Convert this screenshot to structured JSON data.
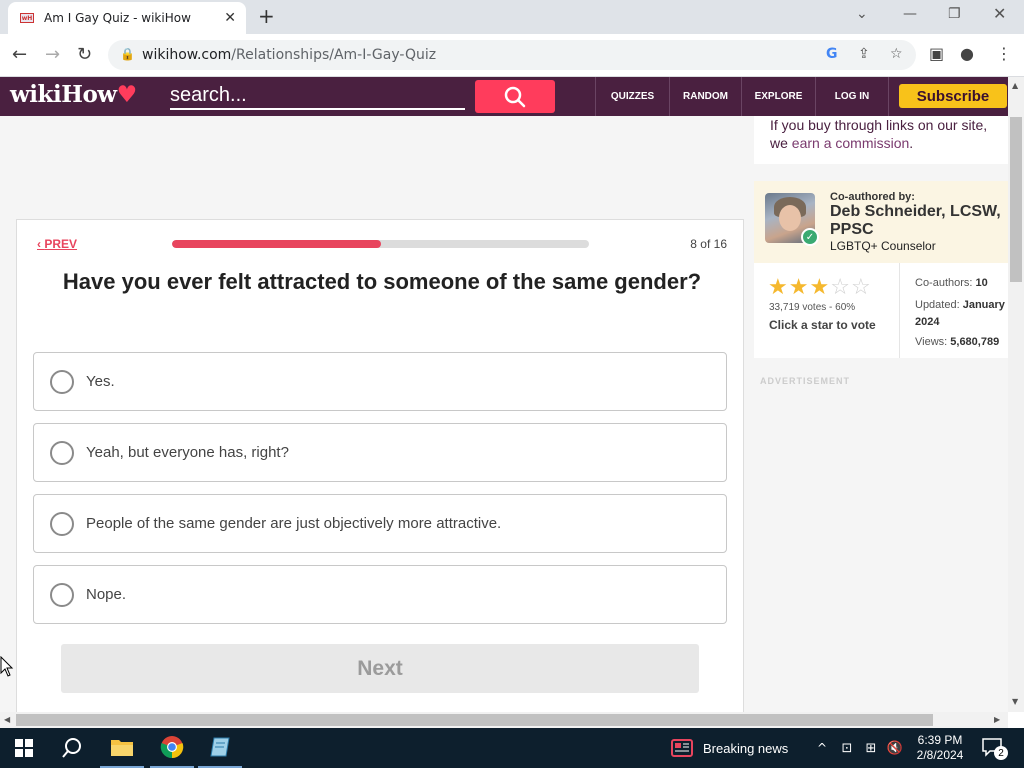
{
  "browser": {
    "tab_title": "Am I Gay Quiz - wikiHow",
    "favicon_text": "wH",
    "new_tab": "+",
    "url_domain": "wikihow.com",
    "url_path": "/Relationships/Am-I-Gay-Quiz"
  },
  "header": {
    "logo_text": "wikiHow",
    "search_placeholder": "search...",
    "nav": [
      "QUIZZES",
      "RANDOM",
      "EXPLORE",
      "LOG IN"
    ],
    "subscribe": "Subscribe"
  },
  "quiz": {
    "prev_label": "PREV",
    "progress_fraction": 0.5,
    "counter": "8 of 16",
    "question": "Have you ever felt attracted to someone of the same gender?",
    "options": [
      "Yes.",
      "Yeah, but everyone has, right?",
      "People of the same gender are just objectively more attractive.",
      "Nope."
    ],
    "next_label": "Next"
  },
  "sidebar": {
    "commission_prefix": "If you buy through links on our site, we ",
    "commission_link": "earn a commission",
    "commission_suffix": ".",
    "coauthored_label": "Co-authored by:",
    "author_name": "Deb Schneider, LCSW, PPSC",
    "author_role": "LGBTQ+ Counselor",
    "rating_stars": 3,
    "rating_max": 5,
    "votes": "33,719 votes - 60%",
    "click_star": "Click a star to vote",
    "coauthors_label": "Co-authors:",
    "coauthors_value": "10",
    "updated_label": "Updated:",
    "updated_value": "January 2024",
    "views_label": "Views:",
    "views_value": "5,680,789",
    "advertisement": "ADVERTISEMENT"
  },
  "taskbar": {
    "news": "Breaking news",
    "time": "6:39 PM",
    "date": "2/8/2024",
    "notifications": "2"
  },
  "colors": {
    "brand": "#4a2040",
    "accent": "#e8455e",
    "subscribe": "#f8c21a"
  }
}
